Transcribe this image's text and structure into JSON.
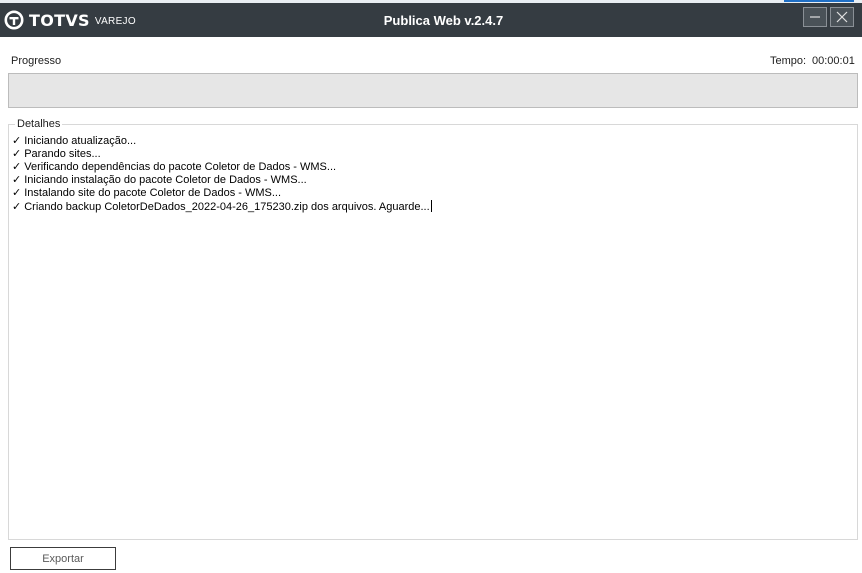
{
  "window": {
    "title": "Publica Web v.2.4.7",
    "logo_text": "TOTVS",
    "logo_sub": "VAREJO"
  },
  "progress": {
    "label": "Progresso",
    "value_percent": 0
  },
  "timer": {
    "label": "Tempo:",
    "value": "00:00:01"
  },
  "details": {
    "legend": "Detalhes",
    "check_glyph": "✓",
    "lines": [
      "Iniciando atualização...",
      "Parando sites...",
      "Verificando dependências do pacote Coletor de Dados - WMS...",
      "Iniciando instalação do pacote Coletor de Dados - WMS...",
      "Instalando site do pacote Coletor de Dados - WMS...",
      "Criando backup ColetorDeDados_2022-04-26_175230.zip dos arquivos. Aguarde..."
    ]
  },
  "actions": {
    "export_label": "Exportar"
  },
  "colors": {
    "titlebar": "#353c42",
    "progress_track": "#e6e6e6",
    "accent": "#1f6fc5"
  }
}
